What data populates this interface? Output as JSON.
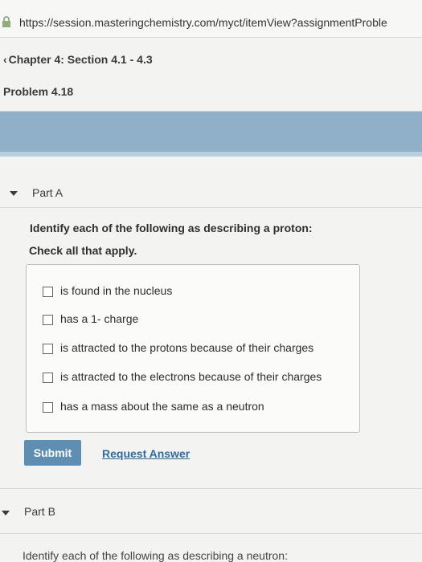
{
  "browser": {
    "url": "https://session.masteringchemistry.com/myct/itemView?assignmentProble"
  },
  "header": {
    "breadcrumb": "Chapter 4: Section 4.1 - 4.3",
    "problem_title": "Problem 4.18"
  },
  "part_a": {
    "title": "Part A",
    "question": "Identify each of the following as describing a proton:",
    "instruction": "Check all that apply.",
    "options": [
      {
        "label": "is found in the nucleus",
        "checked": false
      },
      {
        "label": "has a 1- charge",
        "checked": false
      },
      {
        "label": "is attracted to the protons because of their charges",
        "checked": false
      },
      {
        "label": "is attracted to the electrons because of their charges",
        "checked": false
      },
      {
        "label": "has a mass about the same as a neutron",
        "checked": false
      }
    ],
    "submit_label": "Submit",
    "request_answer_label": "Request Answer"
  },
  "part_b": {
    "title": "Part B",
    "description": "Identify each of the following as describing a neutron:"
  },
  "colors": {
    "band": "#8fb0c8",
    "submit_bg": "#5e8fb3",
    "link": "#2f6ba3"
  }
}
